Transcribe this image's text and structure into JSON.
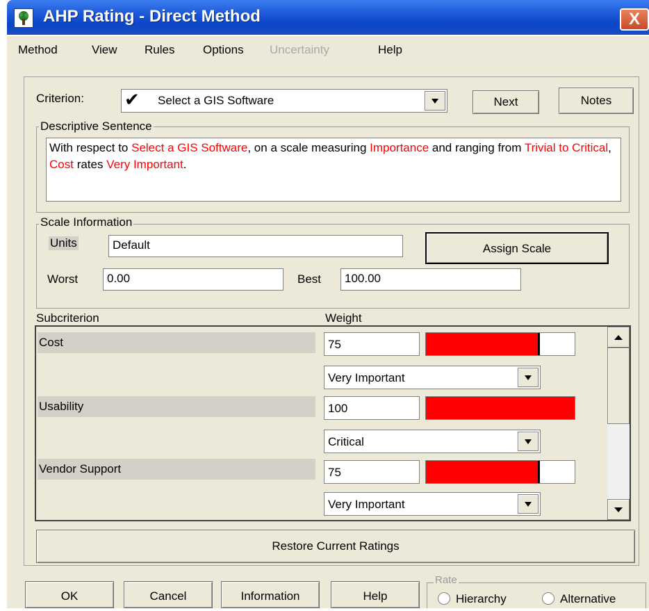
{
  "window": {
    "title": "AHP Rating - Direct Method",
    "close_label": "X"
  },
  "menu": [
    "Method",
    "View",
    "Rules",
    "Options",
    "Uncertainty",
    "Help"
  ],
  "criterion": {
    "label": "Criterion:",
    "checkmark": "✔",
    "value": "Select a GIS Software",
    "next_label": "Next",
    "notes_label": "Notes"
  },
  "descriptive": {
    "title": "Descriptive Sentence",
    "parts": [
      {
        "text": "With respect to ",
        "color": "#000000"
      },
      {
        "text": "Select a GIS Software",
        "color": "#ff0000"
      },
      {
        "text": ", on a scale measuring ",
        "color": "#000000"
      },
      {
        "text": "Importance",
        "color": "#ff0000"
      },
      {
        "text": " and ranging from ",
        "color": "#000000"
      },
      {
        "text": "Trivial to Critical",
        "color": "#ff0000"
      },
      {
        "text": ", ",
        "color": "#000000"
      },
      {
        "text": "Cost",
        "color": "#ff0000"
      },
      {
        "text": " rates ",
        "color": "#000000"
      },
      {
        "text": "Very Important",
        "color": "#ff0000"
      },
      {
        "text": ".",
        "color": "#000000"
      }
    ]
  },
  "scale": {
    "title": "Scale Information",
    "units_label": "Units",
    "units_value": "Default",
    "assign_label": "Assign Scale",
    "worst_label": "Worst",
    "worst_value": "0.00",
    "best_label": "Best",
    "best_value": "100.00"
  },
  "table": {
    "col_subcriterion": "Subcriterion",
    "col_weight": "Weight",
    "rows": [
      {
        "name": "Cost",
        "weight": "75",
        "fraction": 0.75,
        "rating": "Very Important"
      },
      {
        "name": "Usability",
        "weight": "100",
        "fraction": 1.0,
        "rating": "Critical"
      },
      {
        "name": "Vendor Support",
        "weight": "75",
        "fraction": 0.75,
        "rating": "Very Important"
      }
    ]
  },
  "restore_label": "Restore Current Ratings",
  "bottom_buttons": {
    "ok": "OK",
    "cancel": "Cancel",
    "information": "Information",
    "help": "Help"
  },
  "rate": {
    "title": "Rate",
    "option_hierarchy": "Hierarchy",
    "option_alternative": "Alternative"
  },
  "colors": {
    "title_bar": "#1c58d8",
    "highlight": "#ff0000",
    "panel": "#ece9d8"
  }
}
